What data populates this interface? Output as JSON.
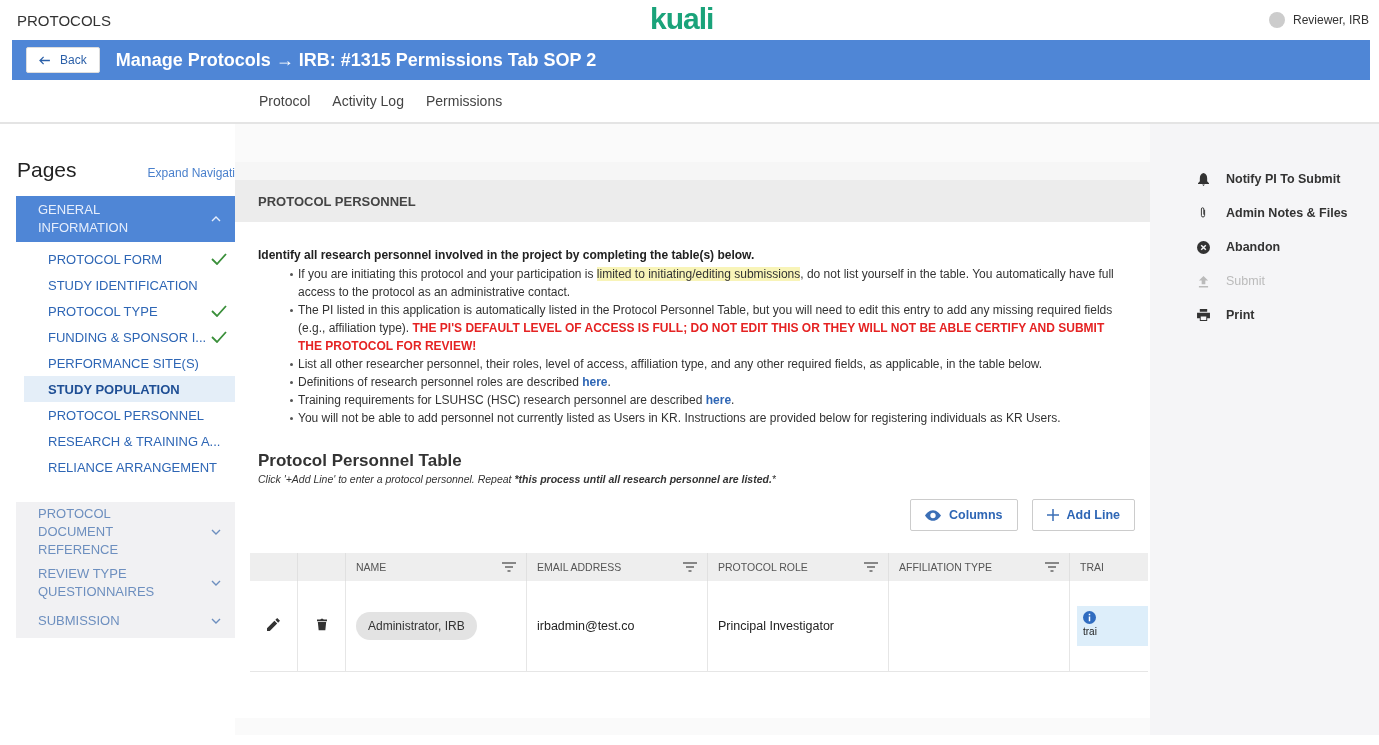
{
  "header": {
    "app_name": "PROTOCOLS",
    "logo": "kuali",
    "user": "Reviewer, IRB"
  },
  "title_bar": {
    "back": "Back",
    "title": "Manage Protocols → IRB: #1315 Permissions Tab SOP 2"
  },
  "tabs": [
    {
      "label": "Protocol"
    },
    {
      "label": "Activity Log"
    },
    {
      "label": "Permissions"
    }
  ],
  "sidebar": {
    "title": "Pages",
    "expand_link": "Expand Navigati",
    "sections": [
      {
        "label": "GENERAL INFORMATION",
        "expanded": true,
        "items": [
          {
            "label": "PROTOCOL FORM",
            "checked": true,
            "selected": false
          },
          {
            "label": "STUDY IDENTIFICATION",
            "checked": false,
            "selected": false
          },
          {
            "label": "PROTOCOL TYPE",
            "checked": true,
            "selected": false
          },
          {
            "label": "FUNDING & SPONSOR I...",
            "checked": true,
            "selected": false
          },
          {
            "label": "PERFORMANCE SITE(S)",
            "checked": false,
            "selected": false
          },
          {
            "label": "STUDY POPULATION",
            "checked": false,
            "selected": true
          },
          {
            "label": "PROTOCOL PERSONNEL",
            "checked": false,
            "selected": false
          },
          {
            "label": "RESEARCH & TRAINING A...",
            "checked": false,
            "selected": false
          },
          {
            "label": "RELIANCE ARRANGEMENT",
            "checked": false,
            "selected": false
          }
        ]
      },
      {
        "label": "PROTOCOL DOCUMENT REFERENCE",
        "expanded": false
      },
      {
        "label": "REVIEW TYPE QUESTIONNAIRES",
        "expanded": false
      },
      {
        "label": "SUBMISSION",
        "expanded": false
      }
    ]
  },
  "section_heading": "PROTOCOL PERSONNEL",
  "intro": "Identify all research personnel involved in the project by completing the table(s) below.",
  "bullets": [
    [
      {
        "kind": "text",
        "text": "If you are initiating this protocol and your participation is "
      },
      {
        "kind": "highlight",
        "text": "limited to initiating/editing submissions"
      },
      {
        "kind": "text",
        "text": ", do not list yourself in the table. You automatically have full access to the protocol as an administrative contact."
      }
    ],
    [
      {
        "kind": "text",
        "text": "The PI listed in this application is automatically listed in the Protocol Personnel Table, but you will need to edit this entry to add any missing required fields (e.g., affiliation type). "
      },
      {
        "kind": "alert",
        "text": "THE PI'S DEFAULT LEVEL OF ACCESS IS FULL; DO NOT EDIT THIS OR THEY WILL NOT BE ABLE CERTIFY AND SUBMIT THE PROTOCOL FOR REVIEW!"
      }
    ],
    [
      {
        "kind": "text",
        "text": "List all other researcher personnel, their roles, level of access, affiliation type, and any other required fields, as applicable, in the table below."
      }
    ],
    [
      {
        "kind": "text",
        "text": "Definitions of research personnel roles are described "
      },
      {
        "kind": "link",
        "text": "here"
      },
      {
        "kind": "text",
        "text": "."
      }
    ],
    [
      {
        "kind": "text",
        "text": "Training requirements for LSUHSC (HSC) research personnel are described "
      },
      {
        "kind": "link",
        "text": "here"
      },
      {
        "kind": "text",
        "text": "."
      }
    ],
    [
      {
        "kind": "text",
        "text": "You will not be able to add personnel not currently listed as Users in KR. Instructions are provided below for registering individuals as KR Users."
      }
    ]
  ],
  "table_title": "Protocol Personnel Table",
  "table_hint": "*Click '+Add Line' to enter a protocol personnel. Repeat* ***this process until all research personnel are listed.***",
  "table_buttons": [
    {
      "kind": "columns",
      "label": "Columns"
    },
    {
      "kind": "add",
      "label": "Add Line"
    }
  ],
  "table": {
    "columns": [
      "NAME",
      "EMAIL ADDRESS",
      "PROTOCOL ROLE",
      "AFFILIATION TYPE",
      "TRAI"
    ],
    "rows": [
      {
        "name": "Administrator, IRB",
        "email": "irbadmin@test.co",
        "role": "Principal Investigator",
        "affiliation": "",
        "training": "trai"
      }
    ]
  },
  "actions": [
    {
      "kind": "bell",
      "label": "Notify PI To Submit",
      "disabled": false
    },
    {
      "kind": "clip",
      "label": "Admin Notes & Files",
      "disabled": false
    },
    {
      "kind": "cancel",
      "label": "Abandon",
      "disabled": false
    },
    {
      "kind": "upload",
      "label": "Submit",
      "disabled": true
    },
    {
      "kind": "print",
      "label": "Print",
      "disabled": false
    }
  ]
}
